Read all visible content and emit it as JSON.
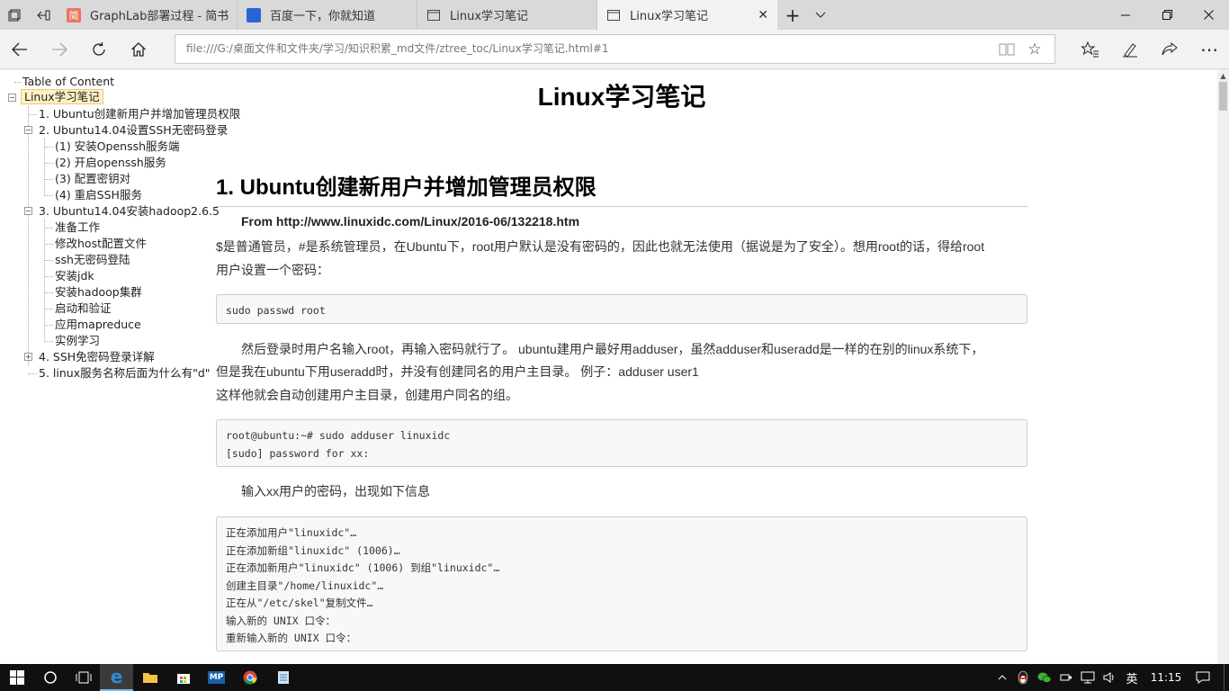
{
  "tabs": [
    {
      "title": "GraphLab部署过程 - 简书",
      "favicon": "jianshu-icon",
      "active": false
    },
    {
      "title": "百度一下，你就知道",
      "favicon": "baidu-paw-icon",
      "active": false
    },
    {
      "title": "Linux学习笔记",
      "favicon": "page-icon",
      "active": false
    },
    {
      "title": "Linux学习笔记",
      "favicon": "page-icon",
      "active": true
    }
  ],
  "address": {
    "url": "file:///G:/桌面文件和文件夹/学习/知识积累_md文件/ztree_toc/Linux学习笔记.html#1"
  },
  "toc": {
    "header": "Table of Content",
    "root": "Linux学习笔记",
    "items": [
      {
        "label": "1. Ubuntu创建新用户并增加管理员权限"
      },
      {
        "label": "2. Ubuntu14.04设置SSH无密码登录"
      },
      {
        "label": "(1) 安装Openssh服务端"
      },
      {
        "label": "(2) 开启openssh服务"
      },
      {
        "label": "(3) 配置密钥对"
      },
      {
        "label": "(4) 重启SSH服务"
      },
      {
        "label": "3. Ubuntu14.04安装hadoop2.6.5"
      },
      {
        "label": "准备工作"
      },
      {
        "label": "修改host配置文件"
      },
      {
        "label": "ssh无密码登陆"
      },
      {
        "label": "安装jdk"
      },
      {
        "label": "安装hadoop集群"
      },
      {
        "label": "启动和验证"
      },
      {
        "label": "应用mapreduce"
      },
      {
        "label": "实例学习"
      },
      {
        "label": "4. SSH免密码登录详解"
      },
      {
        "label": "5. linux服务名称后面为什么有\"d\""
      }
    ]
  },
  "article": {
    "title": "Linux学习笔记",
    "h1": "1. Ubuntu创建新用户并增加管理员权限",
    "from": "From http://www.linuxidc.com/Linux/2016-06/132218.htm",
    "p1_line1": "$是普通管员，#是系统管理员，在Ubuntu下，root用户默认是没有密码的，因此也就无法使用（据说是为了安全）。想用root的话，得给root",
    "p1_line2": "用户设置一个密码：",
    "code1": [
      "sudo passwd root"
    ],
    "p2_line1": "然后登录时用户名输入root，再输入密码就行了。 ubuntu建用户最好用adduser，虽然adduser和useradd是一样的在别的linux系统下，",
    "p2_line2": "但是我在ubuntu下用useradd时，并没有创建同名的用户主目录。 例子：adduser user1",
    "p2_line3": "这样他就会自动创建用户主目录，创建用户同名的组。",
    "code2": [
      "root@ubuntu:~# sudo adduser linuxidc",
      "[sudo] password for xx:"
    ],
    "p3": "输入xx用户的密码，出现如下信息",
    "code3": [
      "正在添加用户\"linuxidc\"…",
      "正在添加新组\"linuxidc\" (1006)…",
      "正在添加新用户\"linuxidc\" (1006) 到组\"linuxidc\"…",
      "创建主目录\"/home/linuxidc\"…",
      "正在从\"/etc/skel\"复制文件…",
      "输入新的 UNIX 口令：",
      "重新输入新的 UNIX 口令："
    ]
  },
  "taskbar": {
    "ime": "英",
    "time": "11:15"
  }
}
